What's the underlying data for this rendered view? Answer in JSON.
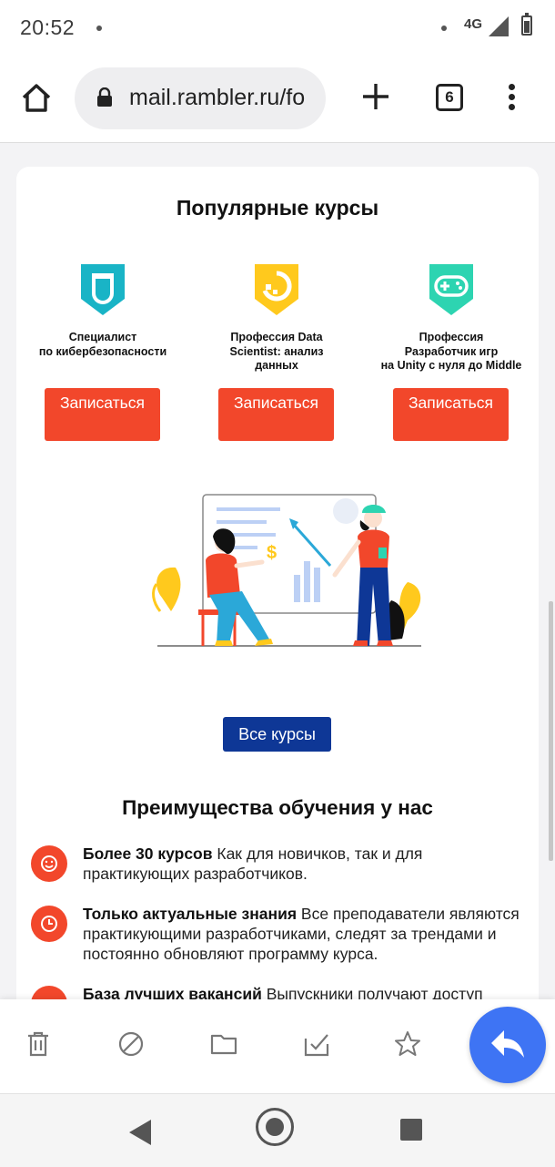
{
  "status": {
    "time": "20:52",
    "network": "4G"
  },
  "browser": {
    "url": "mail.rambler.ru/fo",
    "tab_count": "6"
  },
  "courses": {
    "title": "Популярные курсы",
    "items": [
      {
        "name": "Специалист\nпо кибербезопасности",
        "button": "Записаться",
        "icon": "shield-icon",
        "color": "#19b4c6"
      },
      {
        "name": "Профессия Data\nScientist: анализ\nданных",
        "button": "Записаться",
        "icon": "data-icon",
        "color": "#ffc91d"
      },
      {
        "name": "Профессия\nРазработчик игр\nна Unity с нуля до Middle",
        "button": "Записаться",
        "icon": "gamepad-icon",
        "color": "#2dd4b1"
      }
    ],
    "all_button": "Все курсы"
  },
  "advantages": {
    "title": "Преимущества обучения у нас",
    "items": [
      {
        "bold": "Более 30 курсов",
        "text": " Как для новичков, так и для практикующих разработчиков."
      },
      {
        "bold": "Только актуальные знания",
        "text": " Все преподаватели являются практикующими разработчиками, следят за трендами и постоянно обновляют программу курса."
      },
      {
        "bold": "База лучших вакансий",
        "text": " Выпускники получают доступ"
      }
    ]
  },
  "colors": {
    "accent_red": "#f2472b",
    "accent_blue": "#0e3796",
    "fab_blue": "#3e74f4"
  }
}
